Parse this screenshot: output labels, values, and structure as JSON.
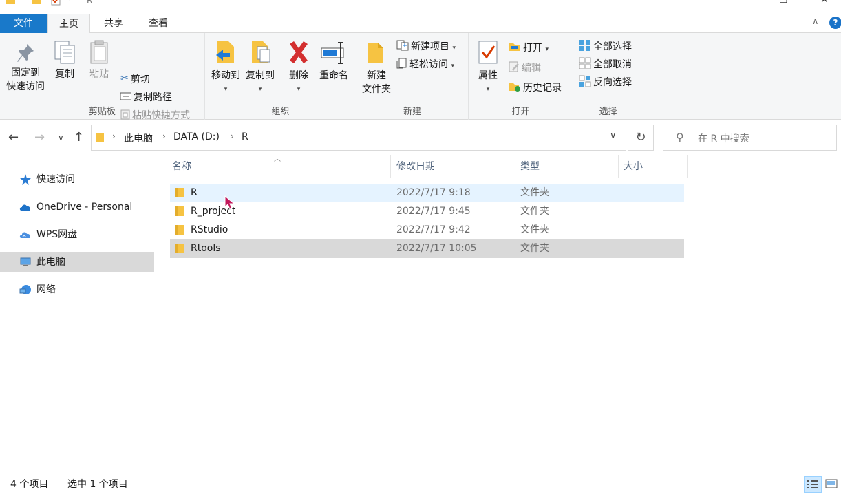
{
  "window": {
    "title": "R"
  },
  "tabs": {
    "file": "文件",
    "home": "主页",
    "share": "共享",
    "view": "查看"
  },
  "ribbon": {
    "clipboard": {
      "label": "剪贴板",
      "pin": "固定到\n快速访问",
      "pin_l1": "固定到",
      "pin_l2": "快速访问",
      "copy": "复制",
      "paste": "粘贴",
      "cut": "剪切",
      "copy_path": "复制路径",
      "paste_shortcut": "粘贴快捷方式"
    },
    "organize": {
      "label": "组织",
      "move_to": "移动到",
      "copy_to": "复制到",
      "delete": "删除",
      "rename": "重命名"
    },
    "new": {
      "label": "新建",
      "new_folder_l1": "新建",
      "new_folder_l2": "文件夹",
      "new_item": "新建项目",
      "easy_access": "轻松访问"
    },
    "open": {
      "label": "打开",
      "properties": "属性",
      "open": "打开",
      "edit": "编辑",
      "history": "历史记录"
    },
    "select": {
      "label": "选择",
      "select_all": "全部选择",
      "select_none": "全部取消",
      "invert": "反向选择"
    }
  },
  "address": {
    "crumbs": [
      "此电脑",
      "DATA (D:)",
      "R"
    ]
  },
  "search": {
    "placeholder": "在 R 中搜索"
  },
  "nav": {
    "items": [
      {
        "label": "快速访问",
        "icon": "star-icon"
      },
      {
        "label": "OneDrive - Personal",
        "icon": "onedrive-cloud-icon"
      },
      {
        "label": "WPS网盘",
        "icon": "wps-cloud-icon"
      },
      {
        "label": "此电脑",
        "icon": "this-pc-icon"
      },
      {
        "label": "网络",
        "icon": "network-icon"
      }
    ]
  },
  "columns": {
    "name": "名称",
    "date": "修改日期",
    "type": "类型",
    "size": "大小"
  },
  "files": [
    {
      "name": "R",
      "date": "2022/7/17 9:18",
      "type": "文件夹"
    },
    {
      "name": "R_project",
      "date": "2022/7/17 9:45",
      "type": "文件夹"
    },
    {
      "name": "RStudio",
      "date": "2022/7/17 9:42",
      "type": "文件夹"
    },
    {
      "name": "Rtools",
      "date": "2022/7/17 10:05",
      "type": "文件夹"
    }
  ],
  "status": {
    "count": "4 个项目",
    "selected": "选中 1 个项目"
  },
  "colors": {
    "accent": "#1979ca",
    "folder": "#f6c342",
    "selected_row": "#d9d9d9",
    "hover_row": "#e5f3ff"
  }
}
